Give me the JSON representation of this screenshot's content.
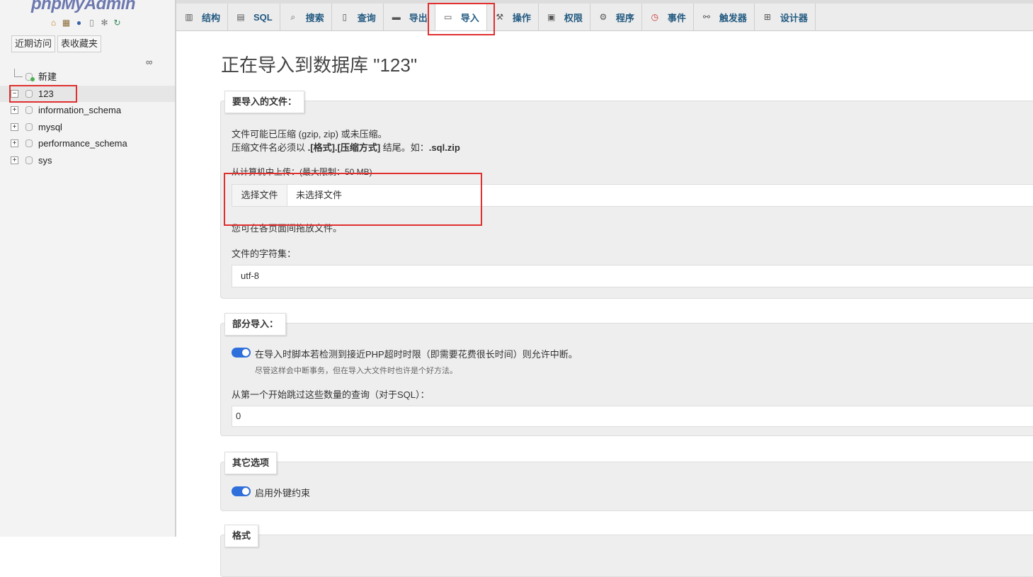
{
  "app": {
    "logo": "phpMyAdmin"
  },
  "nav": {
    "logo_icons": [
      "home-icon",
      "bookmark-icon",
      "help-icon",
      "docs-icon",
      "settings-icon",
      "reload-icon"
    ],
    "recent_label": "近期访问",
    "favorites_label": "表收藏夹",
    "tree": [
      {
        "label": "新建",
        "type": "new"
      },
      {
        "label": "123",
        "type": "db",
        "expanded": true,
        "selected": true
      },
      {
        "label": "information_schema",
        "type": "db"
      },
      {
        "label": "mysql",
        "type": "db"
      },
      {
        "label": "performance_schema",
        "type": "db"
      },
      {
        "label": "sys",
        "type": "db"
      }
    ]
  },
  "tabs": [
    {
      "label": "结构",
      "icon": "structure-icon"
    },
    {
      "label": "SQL",
      "icon": "sql-icon"
    },
    {
      "label": "搜索",
      "icon": "search-icon"
    },
    {
      "label": "查询",
      "icon": "query-icon"
    },
    {
      "label": "导出",
      "icon": "export-icon"
    },
    {
      "label": "导入",
      "icon": "import-icon",
      "active": true
    },
    {
      "label": "操作",
      "icon": "wrench-icon"
    },
    {
      "label": "权限",
      "icon": "privileges-icon"
    },
    {
      "label": "程序",
      "icon": "routines-icon"
    },
    {
      "label": "事件",
      "icon": "events-icon"
    },
    {
      "label": "触发器",
      "icon": "triggers-icon"
    },
    {
      "label": "设计器",
      "icon": "designer-icon"
    }
  ],
  "main": {
    "title": "正在导入到数据库 \"123\"",
    "file_section": {
      "legend": "要导入的文件：",
      "line1": "文件可能已压缩 (gzip, zip) 或未压缩。",
      "line2_prefix": "压缩文件名必须以 ",
      "line2_format": ".[格式].[压缩方式]",
      "line2_middle": " 结尾。如：",
      "line2_example": ".sql.zip",
      "upload_label": "从计算机中上传：(最大限制：50 MB)",
      "choose_button": "选择文件",
      "no_file": "未选择文件",
      "drag_hint": "您可在各页面间拖放文件。",
      "charset_label": "文件的字符集：",
      "charset_value": "utf-8"
    },
    "partial_section": {
      "legend": "部分导入：",
      "interrupt_label": "在导入时脚本若检测到接近PHP超时时限（即需要花费很长时间）则允许中断。",
      "interrupt_note": "尽管这样会中断事务，但在导入大文件时也许是个好方法。",
      "skip_label": "从第一个开始跳过这些数量的查询（对于SQL）：",
      "skip_value": "0"
    },
    "other_section": {
      "legend": "其它选项",
      "fk_label": "启用外键约束"
    },
    "format_section": {
      "legend": "格式"
    }
  }
}
